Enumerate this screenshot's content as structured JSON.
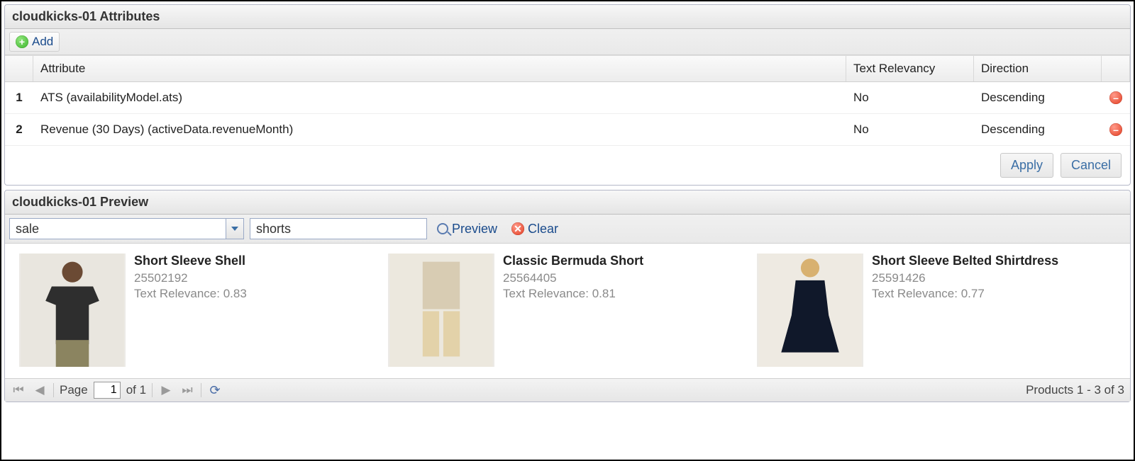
{
  "attributes_panel": {
    "title": "cloudkicks-01 Attributes",
    "add_label": "Add",
    "columns": {
      "attribute": "Attribute",
      "text_relevancy": "Text Relevancy",
      "direction": "Direction"
    },
    "rows": [
      {
        "num": "1",
        "attribute": "ATS (availabilityModel.ats)",
        "text_relevancy": "No",
        "direction": "Descending"
      },
      {
        "num": "2",
        "attribute": "Revenue (30 Days) (activeData.revenueMonth)",
        "text_relevancy": "No",
        "direction": "Descending"
      }
    ],
    "apply_label": "Apply",
    "cancel_label": "Cancel"
  },
  "preview_panel": {
    "title": "cloudkicks-01 Preview",
    "combo_value": "sale",
    "search_value": "shorts",
    "preview_label": "Preview",
    "clear_label": "Clear",
    "relevance_prefix": "Text Relevance: ",
    "products": [
      {
        "title": "Short Sleeve Shell",
        "sku": "25502192",
        "relevance": "0.83",
        "icon": "tee"
      },
      {
        "title": "Classic Bermuda Short",
        "sku": "25564405",
        "relevance": "0.81",
        "icon": "shorts"
      },
      {
        "title": "Short Sleeve Belted Shirtdress",
        "sku": "25591426",
        "relevance": "0.77",
        "icon": "dress"
      }
    ]
  },
  "paging": {
    "page_label": "Page",
    "page_value": "1",
    "of_label": "of 1",
    "status": "Products 1 - 3 of 3"
  }
}
